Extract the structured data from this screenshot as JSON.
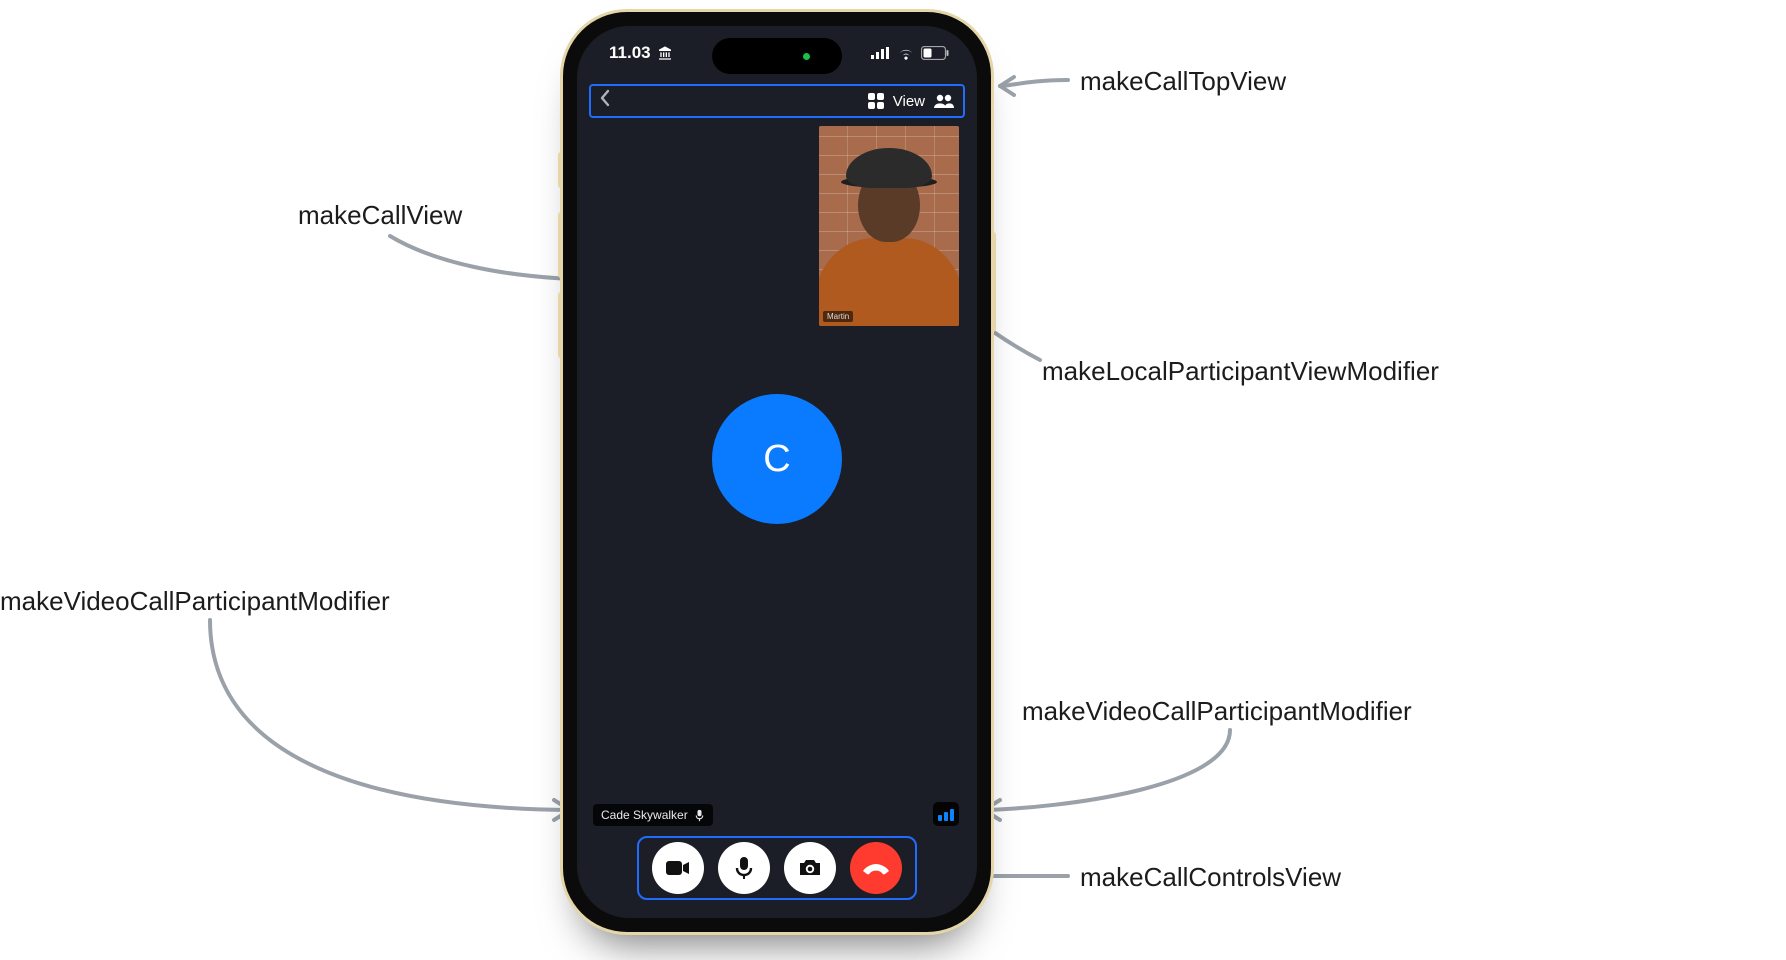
{
  "statusbar": {
    "time": "11.03"
  },
  "topview": {
    "view_label": "View"
  },
  "avatar": {
    "initial": "C"
  },
  "participant": {
    "name": "Cade Skywalker"
  },
  "local": {
    "name_tag": "Martin"
  },
  "annotations": {
    "top": "makeCallTopView",
    "call_view": "makeCallView",
    "local_mod": "makeLocalParticipantViewModifier",
    "participant_mod_left": "makeVideoCallParticipantModifier",
    "participant_mod_right": "makeVideoCallParticipantModifier",
    "controls": "makeCallControlsView"
  }
}
